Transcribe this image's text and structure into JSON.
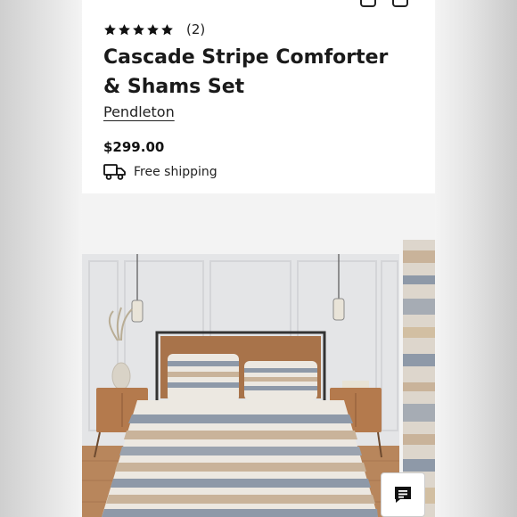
{
  "product": {
    "rating_value": 5,
    "rating_count": "(2)",
    "title": "Cascade Stripe Comforter & Shams Set",
    "brand": "Pendleton",
    "price": "$299.00",
    "shipping_label": "Free shipping"
  },
  "icons": {
    "rating": "star-icon",
    "shipping": "truck-icon",
    "chat": "chat-icon"
  },
  "colors": {
    "text": "#1a1a1a",
    "background": "#ffffff",
    "gallery_background": "#f3f3f3",
    "stripe_tan": "#c9b39a",
    "stripe_slate": "#8e99a8",
    "wood": "#a8734a"
  }
}
